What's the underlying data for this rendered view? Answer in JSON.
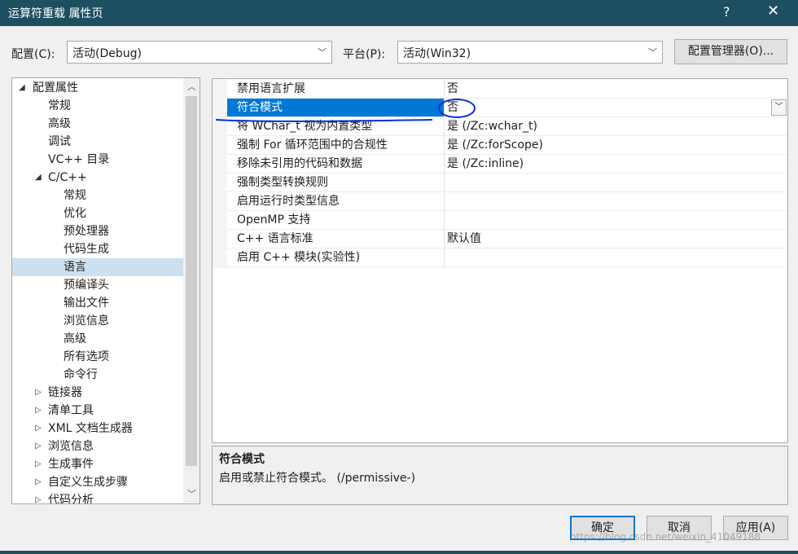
{
  "window": {
    "title": "运算符重载 属性页",
    "help_glyph": "?",
    "close_glyph": "✕"
  },
  "config": {
    "label": "配置(C):",
    "value": "活动(Debug)"
  },
  "platform": {
    "label": "平台(P):",
    "value": "活动(Win32)"
  },
  "config_manager_label": "配置管理器(O)...",
  "tree": {
    "items": [
      {
        "label": "配置属性",
        "expander": "◢"
      },
      {
        "label": "常规"
      },
      {
        "label": "高级"
      },
      {
        "label": "调试"
      },
      {
        "label": "VC++ 目录"
      },
      {
        "label": "C/C++",
        "expander": "◢"
      },
      {
        "label": "常规"
      },
      {
        "label": "优化"
      },
      {
        "label": "预处理器"
      },
      {
        "label": "代码生成"
      },
      {
        "label": "语言"
      },
      {
        "label": "预编译头"
      },
      {
        "label": "输出文件"
      },
      {
        "label": "浏览信息"
      },
      {
        "label": "高级"
      },
      {
        "label": "所有选项"
      },
      {
        "label": "命令行"
      },
      {
        "label": "链接器",
        "expander": "▷"
      },
      {
        "label": "清单工具",
        "expander": "▷"
      },
      {
        "label": "XML 文档生成器",
        "expander": "▷"
      },
      {
        "label": "浏览信息",
        "expander": "▷"
      },
      {
        "label": "生成事件",
        "expander": "▷"
      },
      {
        "label": "自定义生成步骤",
        "expander": "▷"
      },
      {
        "label": "代码分析",
        "expander": "▷"
      }
    ]
  },
  "grid": {
    "rows": [
      {
        "name": "禁用语言扩展",
        "value": "否"
      },
      {
        "name": "符合模式",
        "value": "否"
      },
      {
        "name": "将 WChar_t 视为内置类型",
        "value": "是 (/Zc:wchar_t)"
      },
      {
        "name": "强制 For 循环范围中的合规性",
        "value": "是 (/Zc:forScope)"
      },
      {
        "name": "移除未引用的代码和数据",
        "value": "是 (/Zc:inline)"
      },
      {
        "name": "强制类型转换规则",
        "value": ""
      },
      {
        "name": "启用运行时类型信息",
        "value": ""
      },
      {
        "name": "OpenMP 支持",
        "value": ""
      },
      {
        "name": "C++ 语言标准",
        "value": "默认值"
      },
      {
        "name": "启用 C++ 模块(实验性)",
        "value": ""
      }
    ]
  },
  "description": {
    "title": "符合模式",
    "text": "启用或禁止符合模式。     (/permissive-)"
  },
  "buttons": {
    "ok": "确定",
    "cancel": "取消",
    "apply": "应用(A)"
  },
  "watermark": "https://blog.csdn.net/weixin_41049188",
  "colors": {
    "titlebar": "#1d4f61",
    "selection": "#0078d7",
    "tree_selection": "#cce0f0",
    "annotation": "#0a2fd6"
  }
}
